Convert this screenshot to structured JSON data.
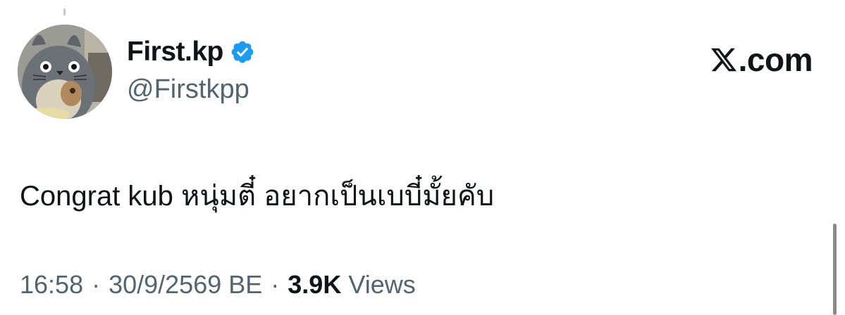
{
  "tweet": {
    "display_name": "First.kp",
    "handle": "@Firstkpp",
    "verified": true,
    "text": "Congrat kub หนุ่มตี๋ อยากเป็นเบบี๋มั้ยคับ",
    "time": "16:58",
    "date": "30/9/2569 BE",
    "separator": "·",
    "views_count": "3.9K",
    "views_label": "Views"
  },
  "brand": {
    "text": ".com",
    "icon": "x-logo-icon"
  },
  "icons": {
    "verified": "verified-badge-icon",
    "avatar": "totoro-avatar"
  },
  "colors": {
    "text_primary": "#0f1419",
    "text_secondary": "#536471",
    "verified_blue": "#1d9bf0",
    "background": "#ffffff"
  }
}
